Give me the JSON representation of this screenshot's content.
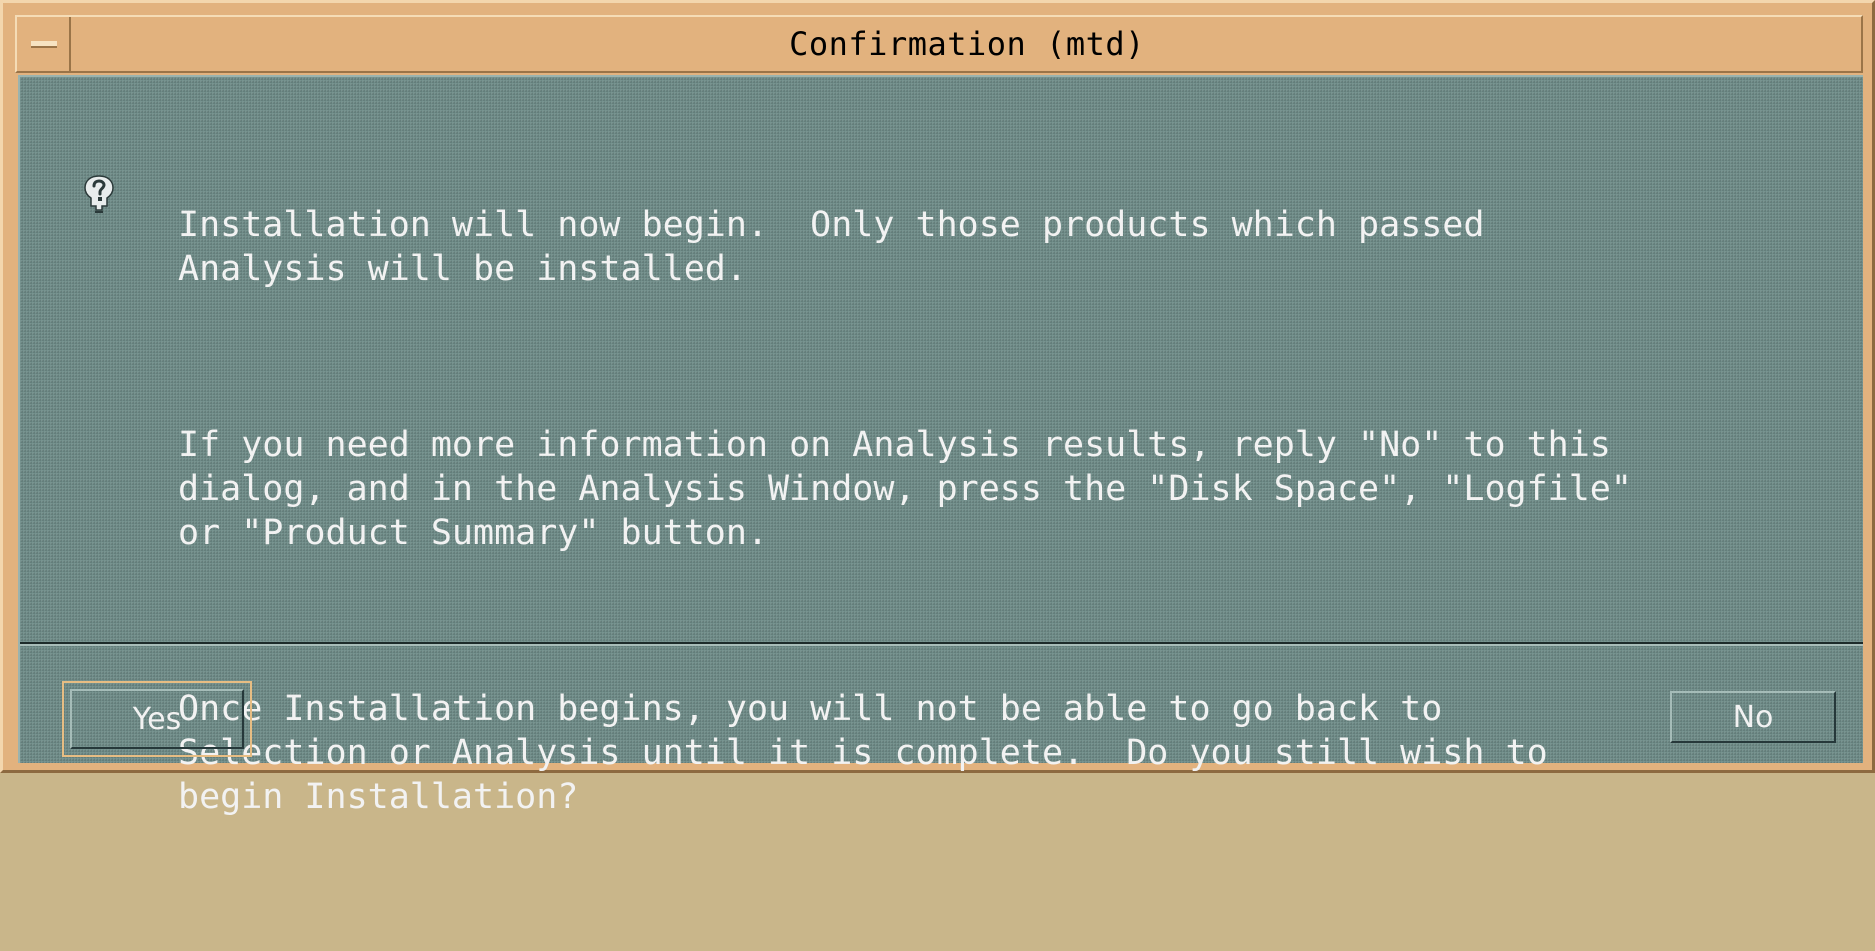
{
  "window": {
    "title": "Confirmation (mtd)"
  },
  "dialog": {
    "icon": "question-icon",
    "paragraphs": [
      "Installation will now begin.  Only those products which passed\nAnalysis will be installed.",
      "If you need more information on Analysis results, reply \"No\" to this\ndialog, and in the Analysis Window, press the \"Disk Space\", \"Logfile\"\nor \"Product Summary\" button.",
      "Once Installation begins, you will not be able to go back to\nSelection or Analysis until it is complete.  Do you still wish to\nbegin Installation?"
    ]
  },
  "buttons": {
    "yes_label": "Yes",
    "no_label": "No"
  },
  "colors": {
    "frame": "#e2b27e",
    "client_background": "#6f8c88",
    "text": "#f2f2f2",
    "default_button_ring": "#e7bd83"
  }
}
